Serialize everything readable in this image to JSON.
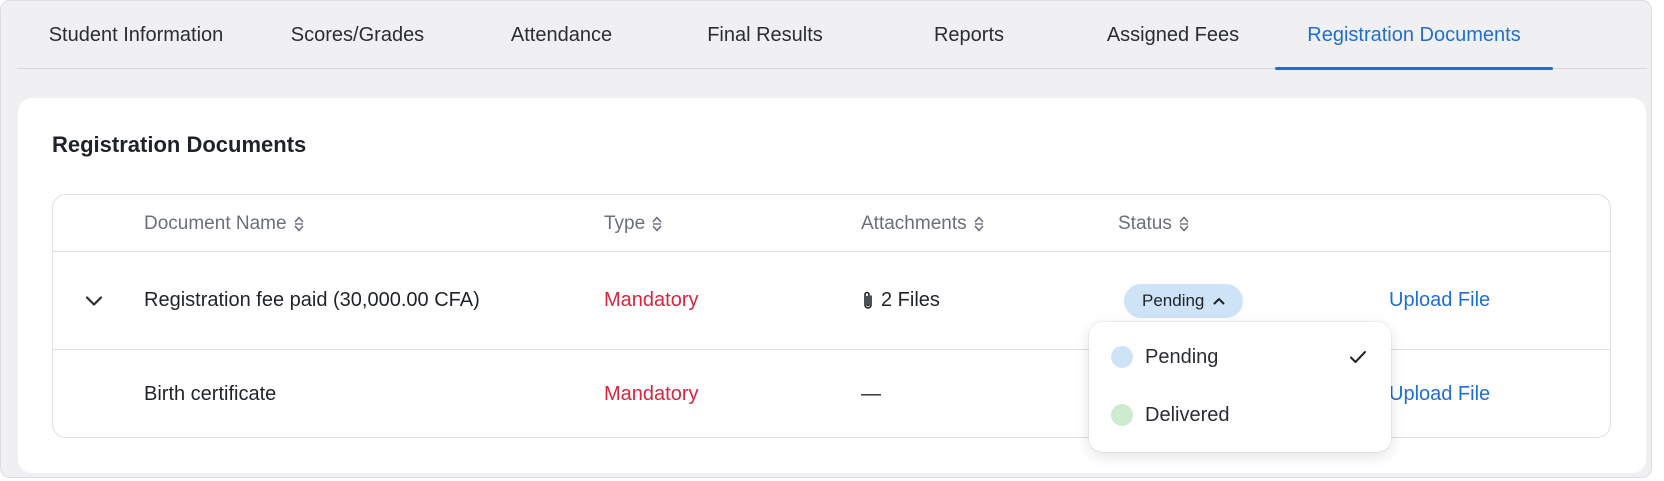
{
  "tabs": [
    {
      "label": "Student Information"
    },
    {
      "label": "Scores/Grades"
    },
    {
      "label": "Attendance"
    },
    {
      "label": "Final Results"
    },
    {
      "label": "Reports"
    },
    {
      "label": "Assigned Fees"
    },
    {
      "label": "Registration Documents",
      "active": true
    }
  ],
  "section": {
    "title": "Registration Documents"
  },
  "table": {
    "columns": {
      "document_name": "Document Name",
      "type": "Type",
      "attachments": "Attachments",
      "status": "Status"
    },
    "rows": [
      {
        "name": "Registration fee paid (30,000.00 CFA)",
        "type": "Mandatory",
        "attachments": "2 Files",
        "status": "Pending",
        "action": "Upload File"
      },
      {
        "name": "Birth certificate",
        "type": "Mandatory",
        "attachments": "—",
        "action": "Upload File"
      }
    ]
  },
  "status_dropdown": {
    "options": [
      {
        "label": "Pending",
        "color": "#cfe3f7",
        "selected": true
      },
      {
        "label": "Delivered",
        "color": "#cdeccf",
        "selected": false
      }
    ]
  },
  "colors": {
    "accent": "#1f6fd1",
    "mandatory": "#d7263d",
    "pending_badge": "#cfe3f7"
  }
}
